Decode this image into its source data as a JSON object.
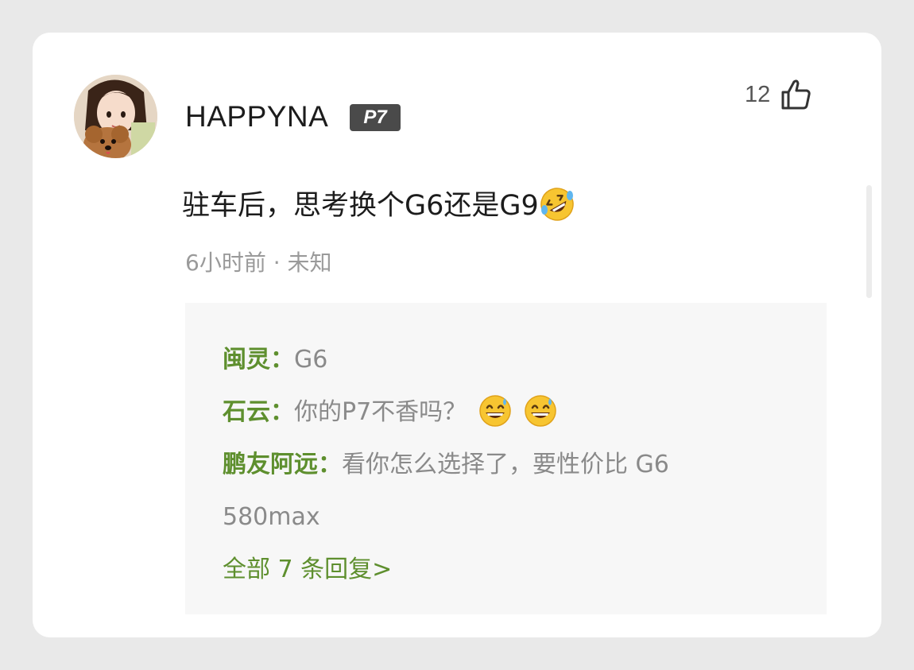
{
  "comment": {
    "username": "HAPPYNA",
    "level_badge": "P7",
    "like_count": "12",
    "text": "驻车后，思考换个G6还是G9",
    "text_emoji": "rolling-on-floor-laughing-emoji",
    "time": "6小时前",
    "separator": "·",
    "location": "未知"
  },
  "replies": [
    {
      "author": "闽灵：",
      "text": "G6",
      "emojis": []
    },
    {
      "author": "石云：",
      "text": "你的P7不香吗？",
      "emojis": [
        "grinning-sweat-emoji",
        "grinning-sweat-emoji"
      ]
    },
    {
      "author": "鹏友阿远：",
      "text": "看你怎么选择了，要性价比 G6",
      "text_cont": "580max",
      "emojis": []
    }
  ],
  "view_all_label": "全部 7 条回复>",
  "colors": {
    "author_green": "#5e8f2e",
    "reply_gray": "#8a8a8a",
    "badge_bg": "#4a4a4a",
    "reply_box_bg": "#f7f7f7"
  }
}
